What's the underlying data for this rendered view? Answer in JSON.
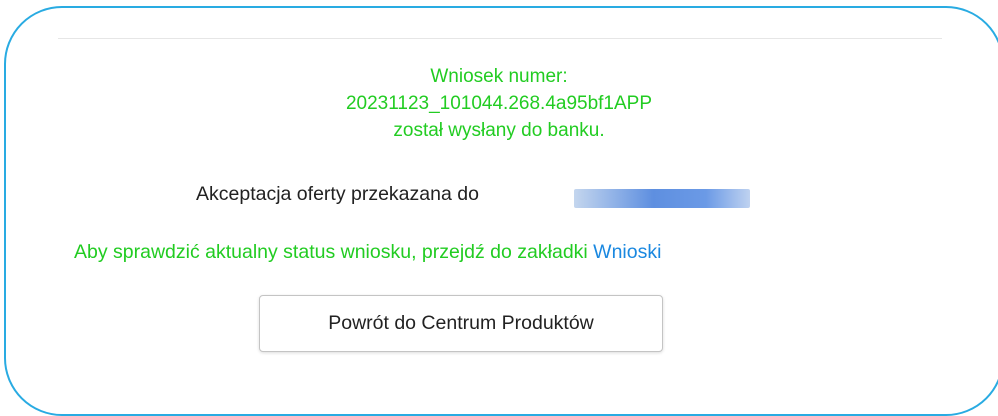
{
  "confirmation": {
    "line1": "Wniosek numer:",
    "line2": "20231123_101044.268.4a95bf1APP",
    "line3": "został wysłany do banku."
  },
  "acceptance": {
    "text": "Akceptacja oferty przekazana do "
  },
  "status": {
    "prefix": "Aby sprawdzić aktualny status wniosku, przejdź do zakładki ",
    "link": "Wnioski"
  },
  "actions": {
    "back_label": "Powrót do Centrum Produktów"
  },
  "colors": {
    "success": "#22cc22",
    "link": "#1a88e0",
    "frame": "#29abe2"
  }
}
